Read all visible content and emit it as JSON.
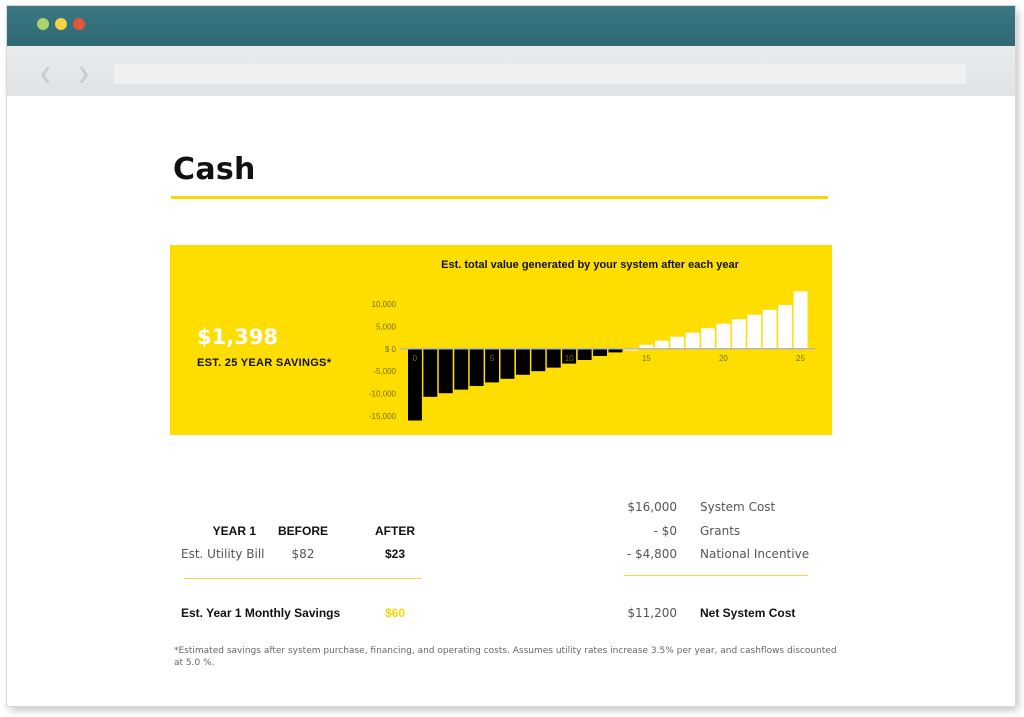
{
  "page": {
    "title": "Cash"
  },
  "panel": {
    "savings_amount": "$1,398",
    "savings_label": "EST. 25 YEAR SAVINGS*"
  },
  "chart_data": {
    "type": "bar",
    "title": "Est. total value generated by your system after each year",
    "xlabel": "",
    "ylabel": "",
    "x_ticks": [
      "0",
      "5",
      "10",
      "15",
      "20",
      "25"
    ],
    "y_ticks": [
      "10,000",
      "5,000",
      "$ 0",
      "-5,000",
      "-10,000",
      "-15,000"
    ],
    "ylim": [
      -15000,
      10000
    ],
    "categories": [
      0,
      1,
      2,
      3,
      4,
      5,
      6,
      7,
      8,
      9,
      10,
      11,
      12,
      13,
      14,
      15,
      16,
      17,
      18,
      19,
      20,
      21,
      22,
      23,
      24,
      25
    ],
    "values": [
      -16000,
      -10700,
      -9900,
      -9100,
      -8300,
      -7500,
      -6700,
      -5800,
      -5000,
      -4200,
      -3300,
      -2500,
      -1600,
      -800,
      0,
      900,
      1800,
      2700,
      3600,
      4600,
      5600,
      6600,
      7600,
      8700,
      9800,
      12800
    ],
    "grid": false,
    "colors": {
      "negative": "#000000",
      "positive": "#ffffff",
      "axis": "#b8b8b8"
    }
  },
  "year1": {
    "headers": {
      "year": "YEAR 1",
      "before": "BEFORE",
      "after": "AFTER"
    },
    "row": {
      "label": "Est. Utility Bill",
      "before": "$82",
      "after": "$23"
    },
    "monthly": {
      "label": "Est. Year 1 Monthly Savings",
      "value": "$60"
    }
  },
  "costs": {
    "items": [
      {
        "amount": "$16,000",
        "label": "System Cost"
      },
      {
        "amount": "- $0",
        "label": "Grants"
      },
      {
        "amount": "- $4,800",
        "label": "National Incentive"
      }
    ],
    "net": {
      "amount": "$11,200",
      "label": "Net System Cost"
    }
  },
  "footnote": "*Estimated savings after system purchase, financing, and operating costs. Assumes utility rates increase 3.5% per year, and cashflows discounted at 5.0 %.",
  "colors": {
    "accent": "#fede00",
    "titlebar": "#2f6873"
  }
}
